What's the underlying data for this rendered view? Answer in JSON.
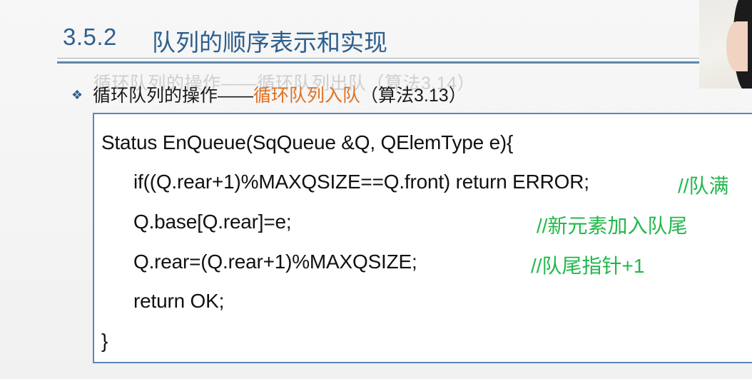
{
  "header": {
    "section_number": "3.5.2",
    "section_title": "队列的顺序表示和实现"
  },
  "ghost_text": "循环队列的操作——循环队列出队（算法3.14）",
  "subtitle": {
    "bullet_icon": "diamond-bullet-icon",
    "prefix": "循环队列的操作——",
    "highlight": "循环队列入队",
    "suffix": "（算法3.13）"
  },
  "code": {
    "line1": "Status EnQueue(SqQueue &Q, QElemType e){",
    "line2": "if((Q.rear+1)%MAXQSIZE==Q.front)  return ERROR;",
    "comment2": "//队满",
    "line3": "Q.base[Q.rear]=e;",
    "comment3": "//新元素加入队尾",
    "line4": "Q.rear=(Q.rear+1)%MAXQSIZE;",
    "comment4": "//队尾指针+1",
    "line5": "return OK;",
    "line6": "}"
  },
  "colors": {
    "title": "#2f5f8e",
    "highlight": "#e07020",
    "comment": "#22b74b",
    "box_border": "#5a87b8"
  }
}
